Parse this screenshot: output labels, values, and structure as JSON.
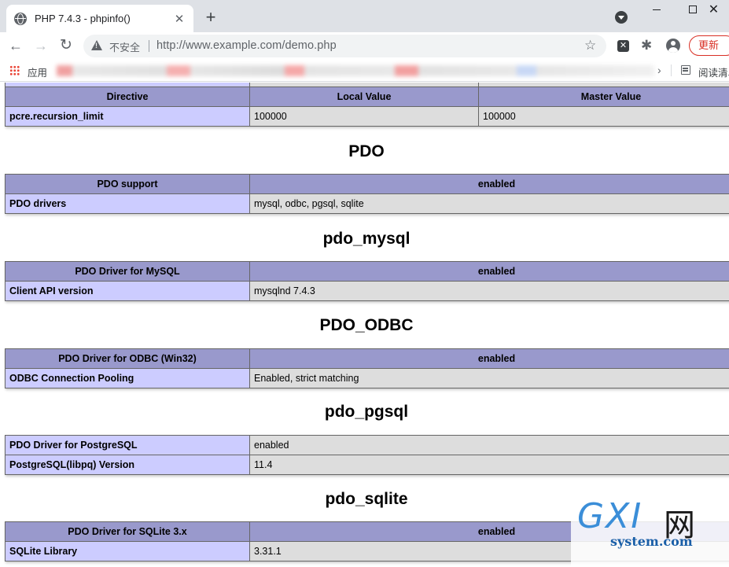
{
  "browser": {
    "tab_title": "PHP 7.4.3 - phpinfo()",
    "new_tab": "+",
    "insecure_label": "不安全",
    "url": "http://www.example.com/demo.php",
    "update_button": "更新",
    "bookmarks_apps": "应用",
    "reading_list": "阅读清单",
    "bookmarks_more": "›"
  },
  "top_table": {
    "headers": [
      "Directive",
      "Local Value",
      "Master Value"
    ],
    "row": {
      "name": "pcre.recursion_limit",
      "local": "100000",
      "master": "100000"
    }
  },
  "sections": {
    "pdo": {
      "title": "PDO",
      "header": {
        "label": "PDO support",
        "value": "enabled"
      },
      "rows": [
        {
          "name": "PDO drivers",
          "value": "mysql, odbc, pgsql, sqlite"
        }
      ]
    },
    "pdo_mysql": {
      "title": "pdo_mysql",
      "header": {
        "label": "PDO Driver for MySQL",
        "value": "enabled"
      },
      "rows": [
        {
          "name": "Client API version",
          "value": "mysqlnd 7.4.3"
        }
      ]
    },
    "pdo_odbc": {
      "title": "PDO_ODBC",
      "header": {
        "label": "PDO Driver for ODBC (Win32)",
        "value": "enabled"
      },
      "rows": [
        {
          "name": "ODBC Connection Pooling",
          "value": "Enabled, strict matching"
        }
      ]
    },
    "pdo_pgsql": {
      "title": "pdo_pgsql",
      "rows": [
        {
          "name": "PDO Driver for PostgreSQL",
          "value": "enabled"
        },
        {
          "name": "PostgreSQL(libpq) Version",
          "value": "11.4"
        }
      ]
    },
    "pdo_sqlite": {
      "title": "pdo_sqlite",
      "header": {
        "label": "PDO Driver for SQLite 3.x",
        "value": "enabled"
      },
      "rows": [
        {
          "name": "SQLite Library",
          "value": "3.31.1"
        }
      ]
    }
  },
  "watermark": {
    "logo": "GXI",
    "logo_cn": "网",
    "site": "system.com"
  },
  "colors": {
    "header_bg": "#9999cc",
    "name_bg": "#ccccff",
    "value_bg": "#dddddd",
    "update_red": "#d93025"
  }
}
